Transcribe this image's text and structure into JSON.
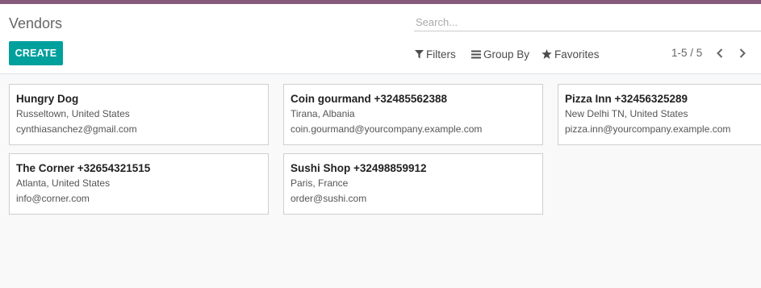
{
  "header": {
    "title": "Vendors"
  },
  "search": {
    "placeholder": "Search..."
  },
  "toolbar": {
    "create_label": "CREATE",
    "filters_label": "Filters",
    "group_by_label": "Group By",
    "favorites_label": "Favorites"
  },
  "pager": {
    "value": "1-5 / 5"
  },
  "colors": {
    "accent": "#00a09d",
    "topbar": "#875a7b"
  },
  "vendors": [
    {
      "name": "Hungry Dog",
      "location": "Russeltown, United States",
      "email": "cynthiasanchez@gmail.com"
    },
    {
      "name": "Coin gourmand +32485562388",
      "location": "Tirana, Albania",
      "email": "coin.gourmand@yourcompany.example.com"
    },
    {
      "name": "Pizza Inn +32456325289",
      "location": "New Delhi TN, United States",
      "email": "pizza.inn@yourcompany.example.com"
    },
    {
      "name": "The Corner +32654321515",
      "location": "Atlanta, United States",
      "email": "info@corner.com"
    },
    {
      "name": "Sushi Shop +32498859912",
      "location": "Paris, France",
      "email": "order@sushi.com"
    }
  ]
}
